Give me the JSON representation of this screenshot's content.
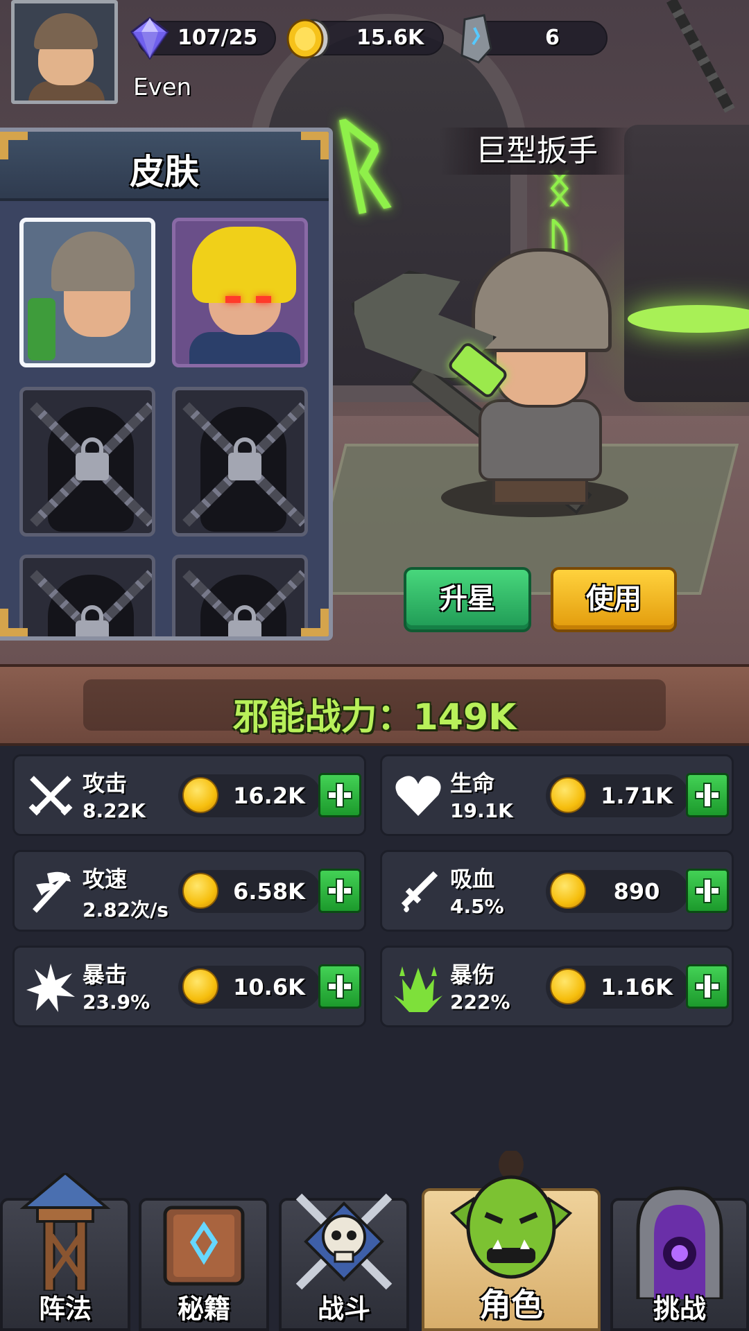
{
  "hud": {
    "player_name": "Even",
    "gems": "107/25",
    "gold": "15.6K",
    "runes": "6"
  },
  "skin_panel": {
    "title": "皮肤",
    "slots": [
      {
        "state": "selected"
      },
      {
        "state": "unlocked"
      },
      {
        "state": "locked"
      },
      {
        "state": "locked"
      },
      {
        "state": "locked"
      },
      {
        "state": "locked"
      }
    ]
  },
  "weapon_name": "巨型扳手",
  "actions": {
    "upgrade_star": "升星",
    "use": "使用"
  },
  "power": {
    "text": "邪能战力：149K"
  },
  "stats": [
    {
      "name": "攻击",
      "value": "8.22K",
      "cost": "16.2K",
      "icon": "crossed-swords-icon"
    },
    {
      "name": "生命",
      "value": "19.1K",
      "cost": "1.71K",
      "icon": "heart-icon"
    },
    {
      "name": "攻速",
      "value": "2.82次/s",
      "cost": "6.58K",
      "icon": "winged-sword-icon"
    },
    {
      "name": "吸血",
      "value": "4.5%",
      "cost": "890",
      "icon": "blood-sword-icon"
    },
    {
      "name": "暴击",
      "value": "23.9%",
      "cost": "10.6K",
      "icon": "crit-burst-icon"
    },
    {
      "name": "暴伤",
      "value": "222%",
      "cost": "1.16K",
      "icon": "crit-damage-icon"
    }
  ],
  "nav": [
    {
      "label": "阵法",
      "icon": "watchtower-icon"
    },
    {
      "label": "秘籍",
      "icon": "rune-book-icon"
    },
    {
      "label": "战斗",
      "icon": "skull-swords-icon"
    },
    {
      "label": "角色",
      "icon": "orc-head-icon",
      "active": true
    },
    {
      "label": "挑战",
      "icon": "portal-icon"
    }
  ],
  "colors": {
    "power_text": "#b8f05a",
    "upgrade_button": "#2fb865",
    "use_button": "#f4b91d",
    "plus_button": "#2fbd41",
    "active_tab": "#e6c487"
  }
}
